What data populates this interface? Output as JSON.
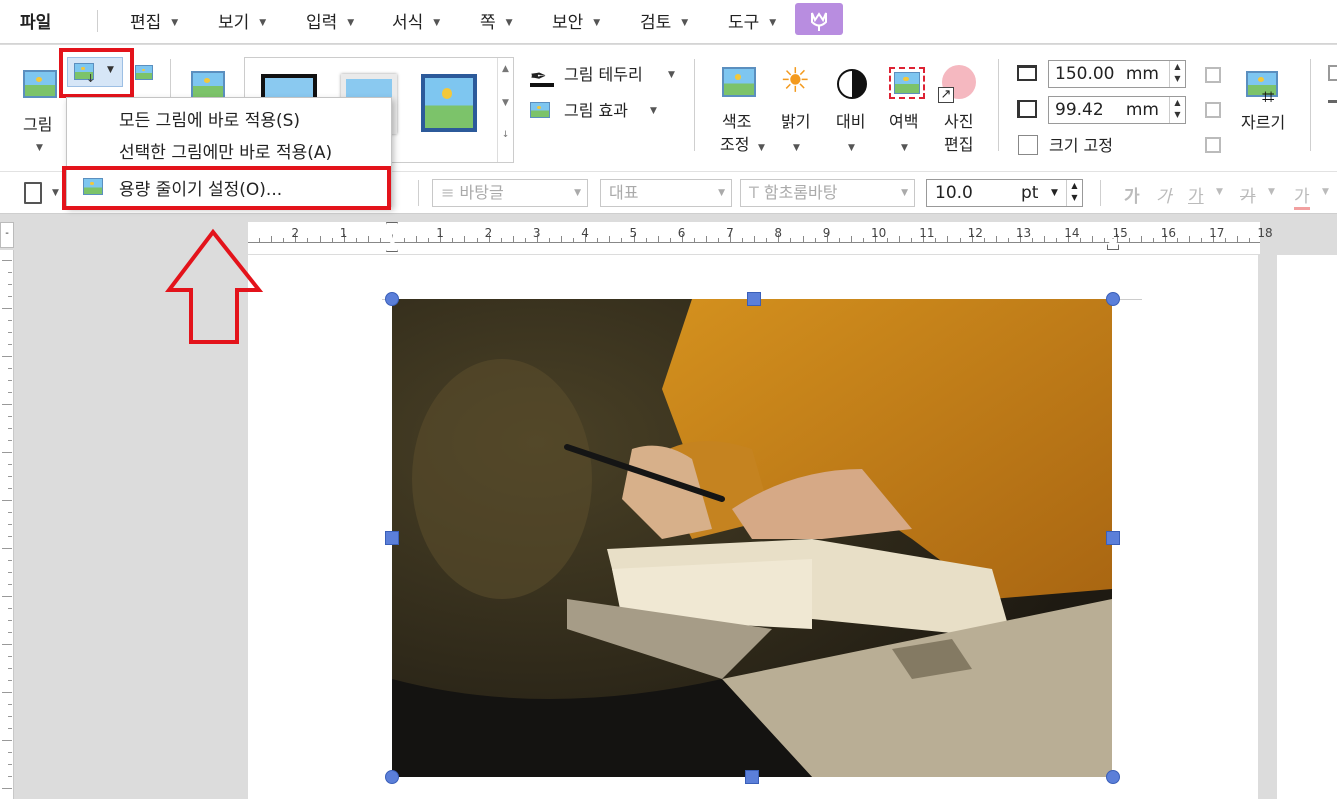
{
  "menu": {
    "file": "파일",
    "items": [
      "편집",
      "보기",
      "입력",
      "서식",
      "쪽",
      "보안",
      "검토",
      "도구"
    ]
  },
  "ribbon": {
    "picture_label": "그림",
    "border_label": "그림 테두리",
    "effect_label": "그림 효과",
    "color_label_1": "색조",
    "color_label_2": "조정",
    "brightness_label": "밝기",
    "contrast_label": "대비",
    "margin_label": "여백",
    "photo_edit_1": "사진",
    "photo_edit_2": "편집",
    "width_value": "150.00",
    "height_value": "99.42",
    "unit": "mm",
    "lock_size_label": "크기 고정",
    "crop_label": "자르기"
  },
  "popup": {
    "item1": "모든 그림에 바로 적용(S)",
    "item2": "선택한 그림에만 바로 적용(A)",
    "item3": "용량 줄이기 설정(O)..."
  },
  "toolbar2": {
    "style": "바탕글",
    "lang": "대표",
    "font": "함초롬바탕",
    "font_size": "10.0",
    "size_unit": "pt"
  },
  "ruler": {
    "numbers": [
      "2",
      "1",
      "1",
      "2",
      "3",
      "4",
      "5",
      "6",
      "7",
      "8",
      "9",
      "10",
      "11",
      "12",
      "13",
      "14",
      "15",
      "16",
      "17",
      "18"
    ]
  },
  "colors": {
    "accent_red": "#e3131b",
    "handle_blue": "#5b7fd9",
    "purple_button": "#b88de0"
  }
}
